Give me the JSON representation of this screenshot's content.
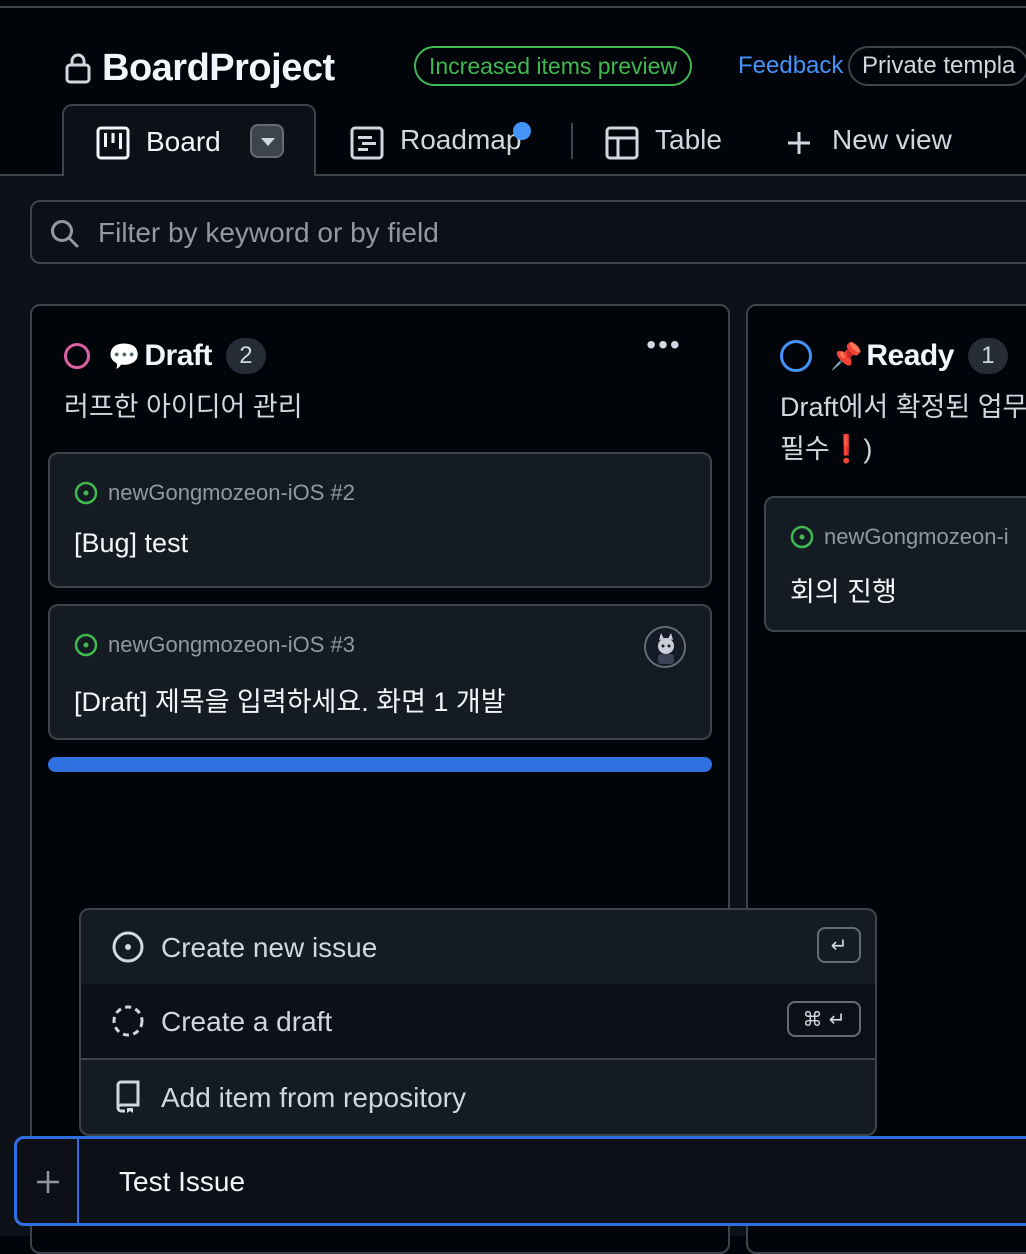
{
  "project": {
    "title": "BoardProject"
  },
  "header": {
    "preview_label": "Increased items preview",
    "feedback_label": "Feedback",
    "template_label": "Private templa"
  },
  "tabs": [
    {
      "label": "Board",
      "icon": "board-icon",
      "active": true
    },
    {
      "label": "Roadmap",
      "icon": "roadmap-icon"
    },
    {
      "label": "Table",
      "icon": "table-icon"
    },
    {
      "label": "New view",
      "icon": "plus-icon"
    }
  ],
  "filter": {
    "placeholder": "Filter by keyword or by field"
  },
  "columns": [
    {
      "emoji": "💬",
      "title": "Draft",
      "count": "2",
      "description": "러프한 아이디어 관리",
      "status_color": "#db61a2",
      "cards": [
        {
          "repo": "newGongmozeon-iOS #2",
          "title": "[Bug] test"
        },
        {
          "repo": "newGongmozeon-iOS #3",
          "title": "[Draft] 제목을 입력하세요. 화면 1 개발",
          "has_avatar": true
        }
      ]
    },
    {
      "emoji": "📌",
      "title": "Ready",
      "count": "1",
      "description_line1": "Draft에서 확정된 업무",
      "description_line2": "필수",
      "description_mark": "❗",
      "description_close": ")",
      "status_color": "#4493f8",
      "cards": [
        {
          "repo": "newGongmozeon-i",
          "title": "회의 진행"
        }
      ]
    }
  ],
  "add_menu": {
    "items": [
      {
        "label": "Create new issue",
        "icon": "issue-opened-icon",
        "shortcut": "↵"
      },
      {
        "label": "Create a draft",
        "icon": "issue-draft-icon",
        "shortcut": "⌘ ↵"
      },
      {
        "label": "Add item from repository",
        "icon": "repo-icon"
      }
    ]
  },
  "add_input": {
    "value": "Test Issue"
  },
  "colors": {
    "accent": "#2f6fe0",
    "open_issue": "#3fb950",
    "background": "#010409"
  }
}
